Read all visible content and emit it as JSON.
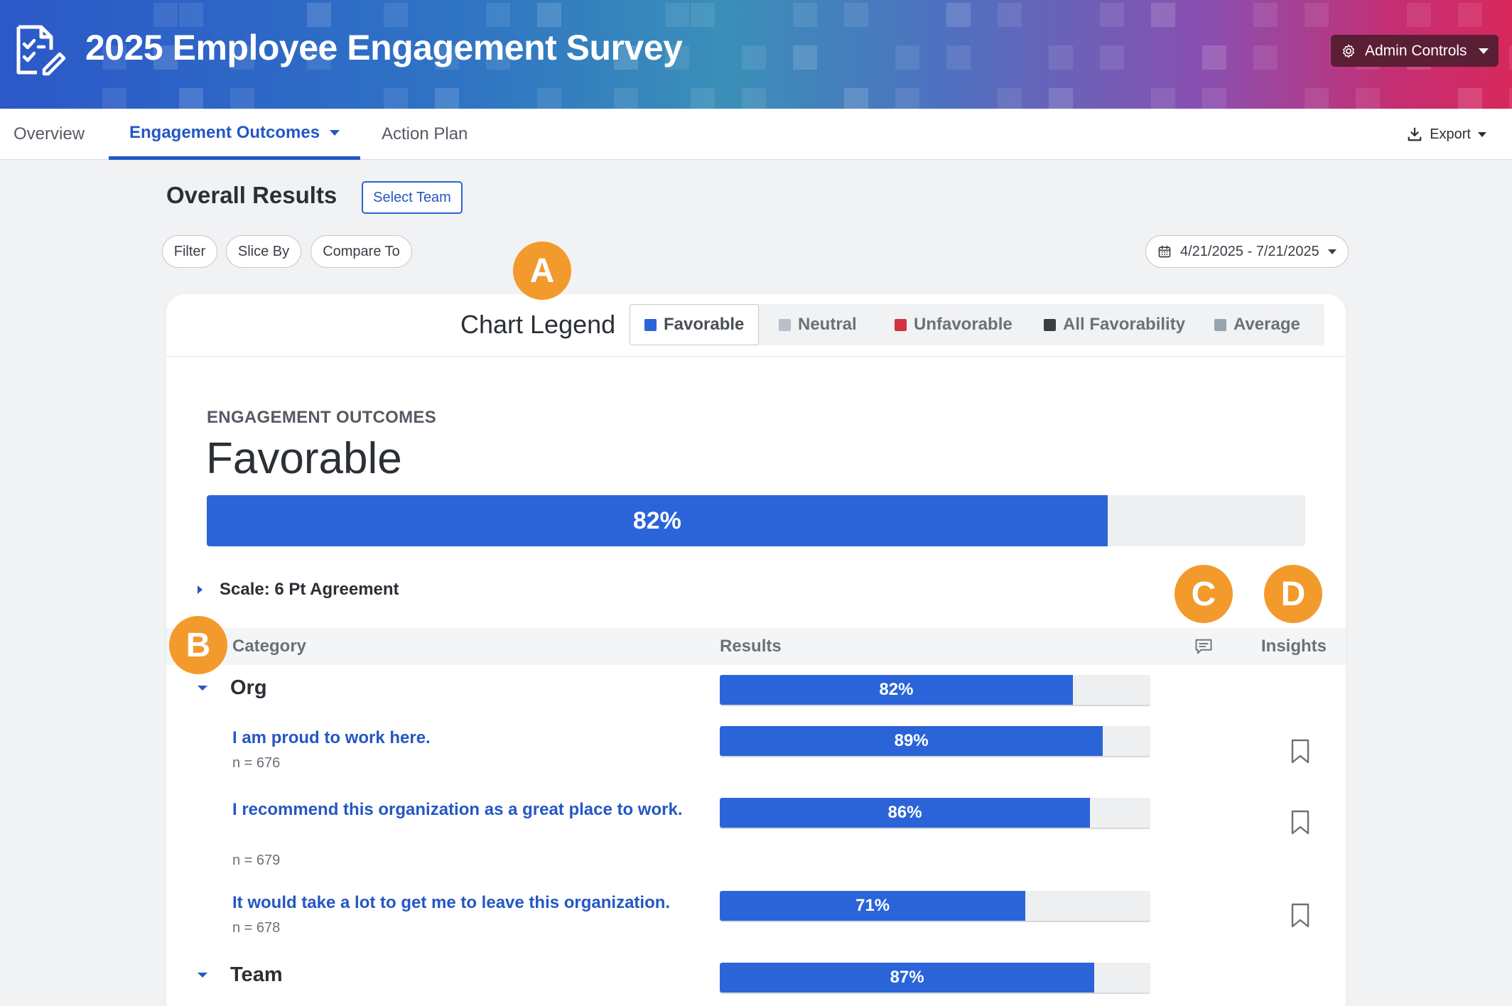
{
  "header": {
    "title": "2025 Employee Engagement Survey",
    "admin_controls": "Admin Controls"
  },
  "nav": {
    "tabs": [
      {
        "label": "Overview"
      },
      {
        "label": "Engagement Outcomes"
      },
      {
        "label": "Action Plan"
      }
    ],
    "export": "Export"
  },
  "toolbar": {
    "title": "Overall Results",
    "select_team": "Select Team",
    "filter": "Filter",
    "slice_by": "Slice By",
    "compare_to": "Compare To",
    "date_range": "4/21/2025 - 7/21/2025"
  },
  "legend": {
    "title": "Chart Legend",
    "items": [
      {
        "label": "Favorable",
        "color": "#2a64d8"
      },
      {
        "label": "Neutral",
        "color": "#b9bfc8"
      },
      {
        "label": "Unfavorable",
        "color": "#d2323f"
      },
      {
        "label": "All Favorability",
        "color": "#3a3d42"
      },
      {
        "label": "Average",
        "color": "#9aa3b2"
      }
    ]
  },
  "summary": {
    "label": "ENGAGEMENT OUTCOMES",
    "value": "Favorable",
    "percent_label": "82%",
    "percent": 82
  },
  "scale": "Scale: 6 Pt Agreement",
  "table": {
    "headers": {
      "category": "Category",
      "results": "Results",
      "insights": "Insights"
    },
    "rows": [
      {
        "kind": "category",
        "label": "Org",
        "percent": 82,
        "percent_label": "82%"
      },
      {
        "kind": "question",
        "label": "I am proud to work here.",
        "n": "n = 676",
        "percent": 89,
        "percent_label": "89%"
      },
      {
        "kind": "question",
        "label": "I recommend this organization as a great place to work.",
        "n": "n = 679",
        "percent": 86,
        "percent_label": "86%"
      },
      {
        "kind": "question",
        "label": "It would take a lot to get me to leave this organization.",
        "n": "n = 678",
        "percent": 71,
        "percent_label": "71%"
      },
      {
        "kind": "category",
        "label": "Team",
        "percent": 87,
        "percent_label": "87%"
      }
    ]
  },
  "callouts": [
    "A",
    "B",
    "C",
    "D"
  ]
}
